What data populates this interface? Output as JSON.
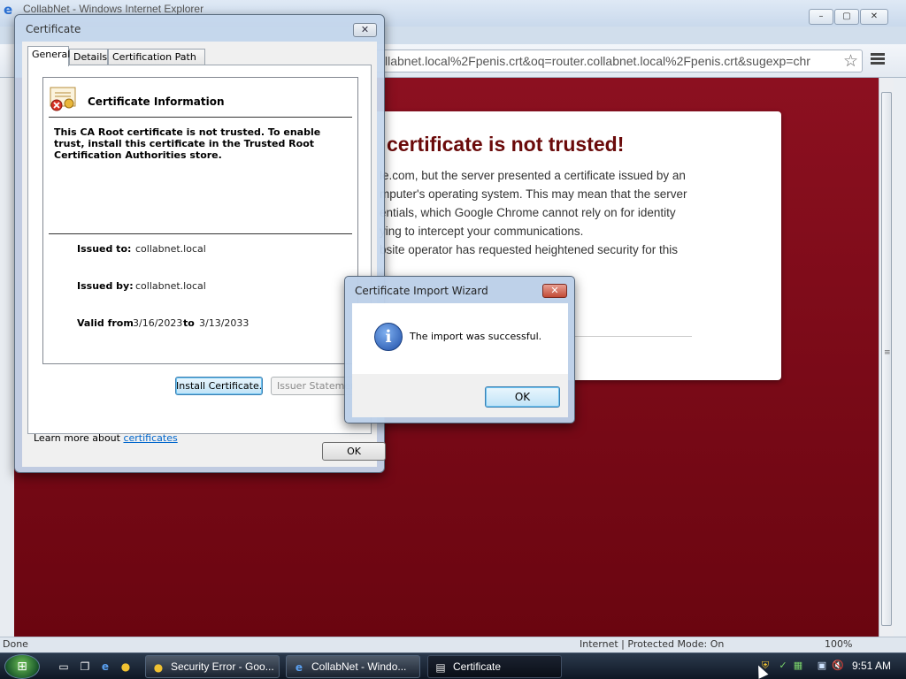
{
  "ie_window": {
    "title": "CollabNet - Windows Internet Explorer",
    "omnibox_text": "llabnet.local%2Fpenis.crt&oq=router.collabnet.local%2Fpenis.crt&sugexp=chr",
    "error_heading": "certificate is not trusted!",
    "error_lines": [
      "le.com, but the server presented a certificate issued by an",
      "mputer's operating system. This may mean that the server",
      "entials, which Google Chrome cannot rely on for identity",
      "ying to intercept your communications.",
      "bsite operator has requested heightened security for this"
    ],
    "status_done": "Done",
    "status_zone": "Internet | Protected Mode: On",
    "status_zoom": "100%",
    "page_bg_color": "#7d0a18"
  },
  "cert_dialog": {
    "title": "Certificate",
    "tabs": [
      "General",
      "Details",
      "Certification Path"
    ],
    "active_tab": "General",
    "info_title": "Certificate Information",
    "warning": "This CA Root certificate is not trusted. To enable trust, install this certificate in the Trusted Root Certification Authorities store.",
    "issued_to_label": "Issued to:",
    "issued_to_value": "collabnet.local",
    "issued_by_label": "Issued by:",
    "issued_by_value": "collabnet.local",
    "valid_from_label": "Valid from",
    "valid_from_value": "3/16/2023",
    "valid_to_label": "to",
    "valid_to_value": "3/13/2033",
    "install_button": "Install Certificate...",
    "issuer_statement_button": "Issuer Statement",
    "learn_more_prefix": "Learn more about ",
    "learn_more_link": "certificates",
    "ok_button": "OK"
  },
  "wizard": {
    "title": "Certificate Import Wizard",
    "message": "The import was successful.",
    "ok_button": "OK",
    "icon": "information-icon"
  },
  "taskbar": {
    "tasks": [
      {
        "label": "Security Error - Goo...",
        "icon": "chrome-icon"
      },
      {
        "label": "CollabNet - Windo...",
        "icon": "ie-icon"
      },
      {
        "label": "Certificate",
        "icon": "certificate-icon"
      }
    ],
    "active_task": "Certificate",
    "clock": "9:51 AM"
  }
}
